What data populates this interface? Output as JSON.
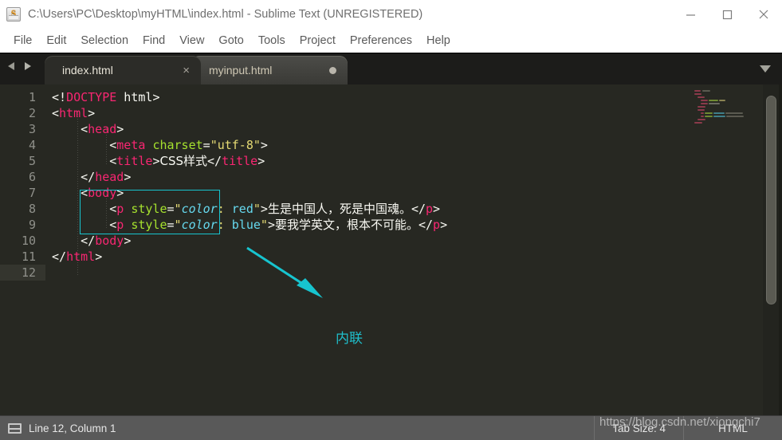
{
  "window": {
    "title": "C:\\Users\\PC\\Desktop\\myHTML\\index.html - Sublime Text (UNREGISTERED)",
    "icon": "sublime-text-icon",
    "minimize_label": "—",
    "maximize_label": "□",
    "close_label": "✕"
  },
  "menubar": {
    "items": [
      {
        "label": "File"
      },
      {
        "label": "Edit"
      },
      {
        "label": "Selection"
      },
      {
        "label": "Find"
      },
      {
        "label": "View"
      },
      {
        "label": "Goto"
      },
      {
        "label": "Tools"
      },
      {
        "label": "Project"
      },
      {
        "label": "Preferences"
      },
      {
        "label": "Help"
      }
    ]
  },
  "tabbar": {
    "nav_back": "back-arrow-icon",
    "nav_forward": "forward-arrow-icon",
    "dropdown": "tab-list-dropdown-icon",
    "tabs": [
      {
        "label": "index.html",
        "active": true,
        "dirty": false,
        "close_glyph": "×"
      },
      {
        "label": "myinput.html",
        "active": false,
        "dirty": true,
        "close_glyph": "●"
      }
    ]
  },
  "editor": {
    "language": "HTML",
    "line_numbers": [
      "1",
      "2",
      "3",
      "4",
      "5",
      "6",
      "7",
      "8",
      "9",
      "10",
      "11",
      "12"
    ],
    "current_line": 12,
    "colors": {
      "background": "#272822",
      "tag": "#f92672",
      "attribute": "#a6e22e",
      "string": "#e6db74",
      "value": "#66d9ef",
      "text": "#f8f8f2",
      "line_number": "#8f908a",
      "current_line_bg": "#34352e",
      "annotation": "#1fbecb"
    },
    "code_lines": [
      {
        "n": 1,
        "text": "<!DOCTYPE html>"
      },
      {
        "n": 2,
        "text": "<html>"
      },
      {
        "n": 3,
        "text": "    <head>"
      },
      {
        "n": 4,
        "text": "        <meta charset=\"utf-8\">"
      },
      {
        "n": 5,
        "text": "        <title>CSS样式</title>"
      },
      {
        "n": 6,
        "text": "    </head>"
      },
      {
        "n": 7,
        "text": "    <body>"
      },
      {
        "n": 8,
        "text": "        <p style=\"color: red\">生是中国人，死是中国魂。</p>"
      },
      {
        "n": 9,
        "text": "        <p style=\"color: blue\">要我学英文，根本不可能。</p>"
      },
      {
        "n": 10,
        "text": "    </body>"
      },
      {
        "n": 11,
        "text": "</html>"
      },
      {
        "n": 12,
        "text": ""
      }
    ],
    "tokens": {
      "l1": {
        "lt": "<!",
        "tag": "DOCTYPE",
        "rest": " html",
        "gt": ">"
      },
      "l2": {
        "lt": "<",
        "tag": "html",
        "gt": ">"
      },
      "l3": {
        "lt": "<",
        "tag": "head",
        "gt": ">"
      },
      "l4": {
        "lt": "<",
        "tag": "meta",
        "space": " ",
        "attr": "charset",
        "eq": "=",
        "str": "\"utf-8\"",
        "gt": ">"
      },
      "l5": {
        "lt": "<",
        "tag": "title",
        "gt": ">",
        "content": "CSS样式",
        "close_lt": "</",
        "close_tag": "title",
        "close_gt": ">"
      },
      "l6": {
        "lt": "</",
        "tag": "head",
        "gt": ">"
      },
      "l7": {
        "lt": "<",
        "tag": "body",
        "gt": ">"
      },
      "l8": {
        "lt": "<",
        "tag": "p",
        "space": " ",
        "attr": "style",
        "eq": "=",
        "q1": "\"",
        "prop": "color",
        "colon": ": ",
        "val": "red",
        "q2": "\"",
        "gt": ">",
        "content": "生是中国人，死是中国魂。",
        "close_lt": "</",
        "close_tag": "p",
        "close_gt": ">"
      },
      "l9": {
        "lt": "<",
        "tag": "p",
        "space": " ",
        "attr": "style",
        "eq": "=",
        "q1": "\"",
        "prop": "color",
        "colon": ": ",
        "val": "blue",
        "q2": "\"",
        "gt": ">",
        "content": "要我学英文，根本不可能。",
        "close_lt": "</",
        "close_tag": "p",
        "close_gt": ">"
      },
      "l10": {
        "lt": "</",
        "tag": "body",
        "gt": ">"
      },
      "l11": {
        "lt": "</",
        "tag": "html",
        "gt": ">"
      }
    },
    "annotation": {
      "label": "内联",
      "highlight_name": "inline-style-highlight-box",
      "arrow_name": "annotation-arrow"
    }
  },
  "statusbar": {
    "layout_icon": "panel-layout-icon",
    "position": "Line 12, Column 1",
    "tab_size": "Tab Size: 4",
    "syntax": "HTML"
  },
  "watermark": {
    "text": "https://blog.csdn.net/xiongchi7"
  }
}
